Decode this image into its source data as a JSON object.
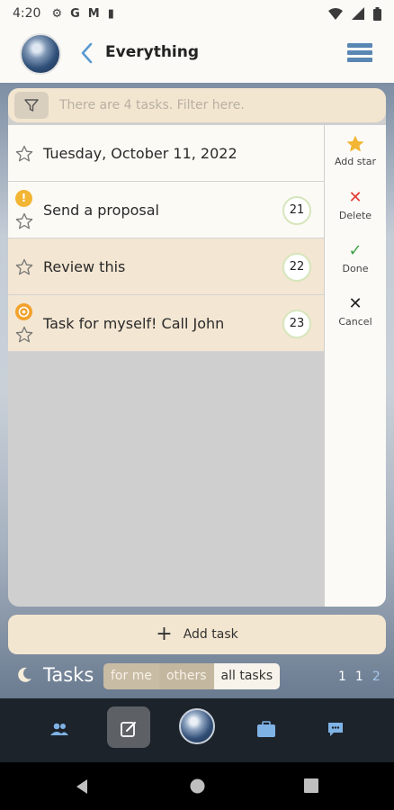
{
  "status": {
    "time": "4:20",
    "icons": [
      "gear-icon",
      "google-icon",
      "gmail-icon",
      "sim-icon"
    ],
    "right_icons": [
      "wifi-icon",
      "signal-icon",
      "battery-icon"
    ]
  },
  "header": {
    "title": "Everything"
  },
  "filter": {
    "placeholder": "There are 4 tasks. Filter here."
  },
  "tasks": [
    {
      "title": "Tuesday, October 11, 2022",
      "number": "",
      "flag": ""
    },
    {
      "title": "Send a proposal",
      "number": "21",
      "flag": "!"
    },
    {
      "title": "Review this",
      "number": "22",
      "flag": ""
    },
    {
      "title": "Task for myself! Call John",
      "number": "23",
      "flag": "self"
    }
  ],
  "side_menu": [
    {
      "label": "Add star",
      "icon": "star-icon"
    },
    {
      "label": "Delete",
      "icon": "x-icon"
    },
    {
      "label": "Done",
      "icon": "check-icon"
    },
    {
      "label": "Cancel",
      "icon": "close-icon"
    }
  ],
  "add_task": {
    "label": "Add task"
  },
  "tasks_bar": {
    "label": "Tasks",
    "segments": [
      "for me",
      "others",
      "all tasks"
    ],
    "selected": "all tasks",
    "counts": [
      "1",
      "1",
      "2"
    ]
  },
  "bottom_nav": [
    "people-icon",
    "edit-icon",
    "avatar",
    "briefcase-icon",
    "chat-icon"
  ],
  "colors": {
    "accent": "#5a86b4",
    "tan": "#f3e6d0",
    "star": "#f2b534"
  }
}
